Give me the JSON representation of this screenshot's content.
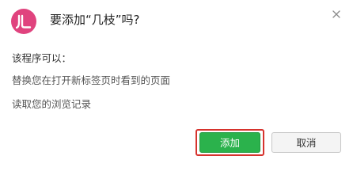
{
  "dialog": {
    "title": "要添加“几枝”吗?",
    "extension_icon": "jizhi-logo-icon",
    "close_icon": "close-icon",
    "permissions_heading": "该程序可以：",
    "permissions": [
      "替换您在打开新标签页时看到的页面",
      "读取您的浏览记录"
    ],
    "add_label": "添加",
    "cancel_label": "取消"
  },
  "colors": {
    "brand": "#e0437e",
    "add_button": "#2bb24c",
    "highlight": "#d6332d"
  }
}
